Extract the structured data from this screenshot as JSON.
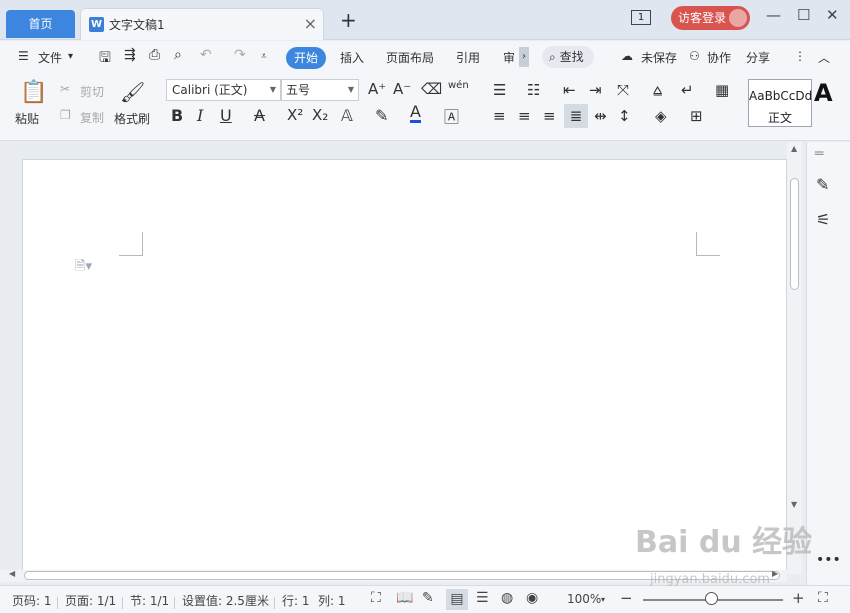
{
  "titlebar": {
    "home_tab": "首页",
    "doc_tab": "文字文稿1",
    "doc_tab_icon": "W",
    "close": "×",
    "add": "+",
    "page_indicator": "1",
    "login": "访客登录",
    "min": "—",
    "max": "☐",
    "close_win": "✕"
  },
  "menubar": {
    "file": "文件",
    "tabs": [
      "开始",
      "插入",
      "页面布局",
      "引用",
      "审"
    ],
    "search": "查找",
    "unsaved": "未保存",
    "collab": "协作",
    "share": "分享"
  },
  "ribbon": {
    "paste": "粘贴",
    "cut": "剪切",
    "copy": "复制",
    "format_painter": "格式刷",
    "font_name": "Calibri (正文)",
    "font_size": "五号",
    "pinyin": "wén",
    "style_sample": "AaBbCcDd",
    "style_name": "正文",
    "style_big": "A"
  },
  "statusbar": {
    "page": "页码: 1",
    "pages": "页面: 1/1",
    "section": "节: 1/1",
    "setting": "设置值: 2.5厘米",
    "row": "行: 1",
    "col": "列: 1",
    "zoom": "100%",
    "zoom_level": 1.0
  },
  "watermark": {
    "logo": "Bai du 经验",
    "url": "jingyan.baidu.com"
  },
  "colors": {
    "accent": "#3d86e0",
    "login": "#d9534f",
    "font_color_underline": "#1f4fd6",
    "highlight": "#f0c419"
  }
}
